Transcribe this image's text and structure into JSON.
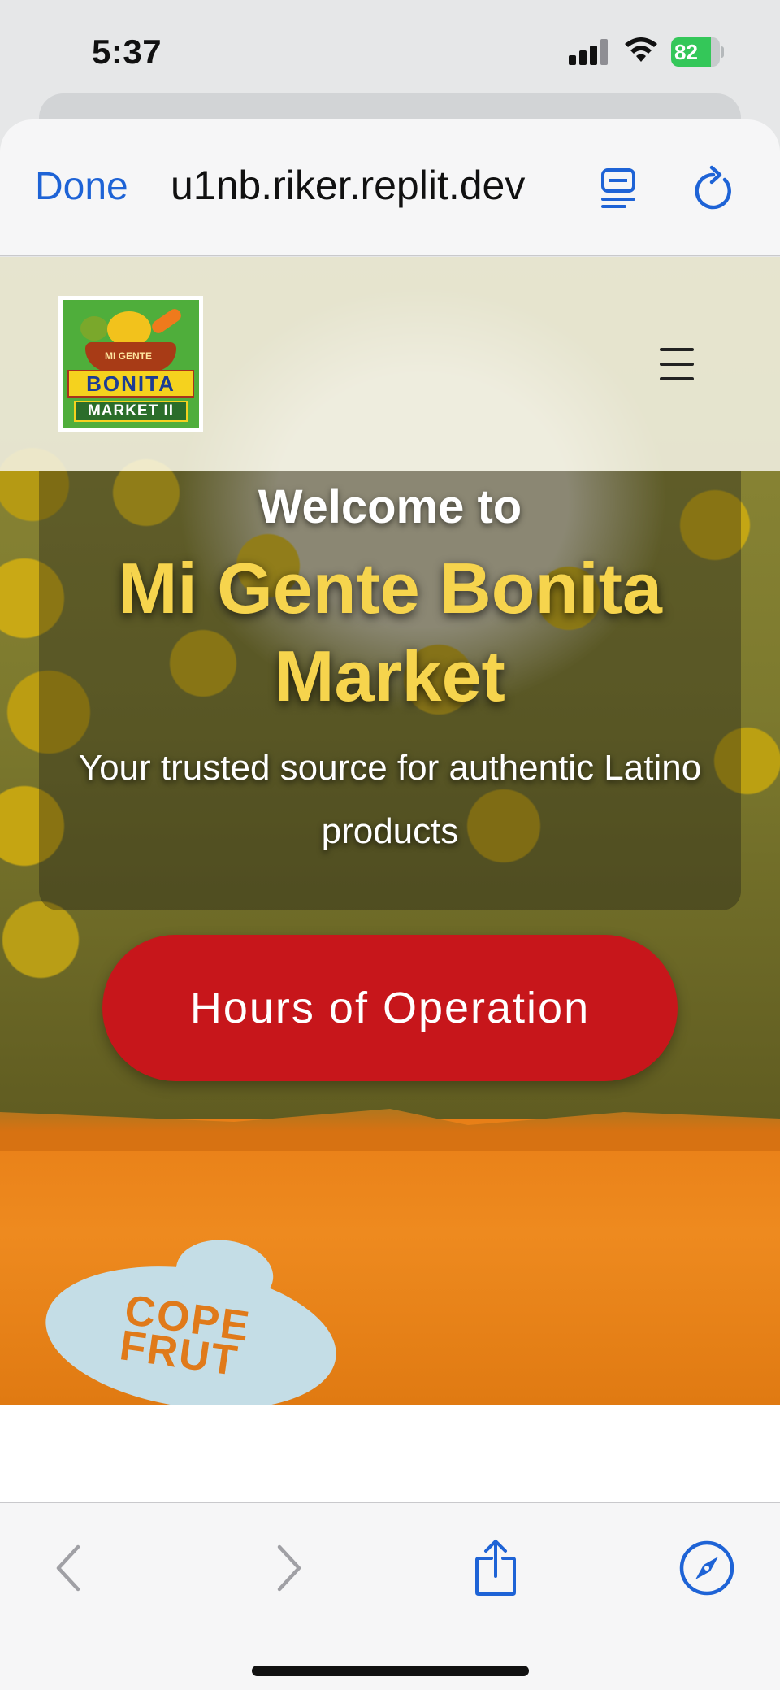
{
  "status_bar": {
    "time": "5:37",
    "battery_percent": "82",
    "battery_level": 0.82,
    "battery_color": "#34c759"
  },
  "browser": {
    "done_label": "Done",
    "url": "u1nb.riker.replit.dev",
    "accent_color": "#1e63d6",
    "icons": {
      "reader": "reader-view-icon",
      "reload": "reload-icon",
      "back": "chevron-left-icon",
      "forward": "chevron-right-icon",
      "share": "share-icon",
      "safari": "compass-icon"
    }
  },
  "site": {
    "logo": {
      "line1": "MI GENTE",
      "line2": "BONITA",
      "line3": "MARKET II"
    },
    "menu_icon": "hamburger-menu-icon",
    "hero": {
      "welcome": "Welcome to",
      "title": "Mi Gente Bonita Market",
      "subtitle": "Your trusted source for authentic Latino products",
      "button_label": "Hours of Operation",
      "title_color": "#f6d44d",
      "button_color": "#c7161b"
    },
    "background_sticker": {
      "text": "COPE FRUT"
    }
  }
}
